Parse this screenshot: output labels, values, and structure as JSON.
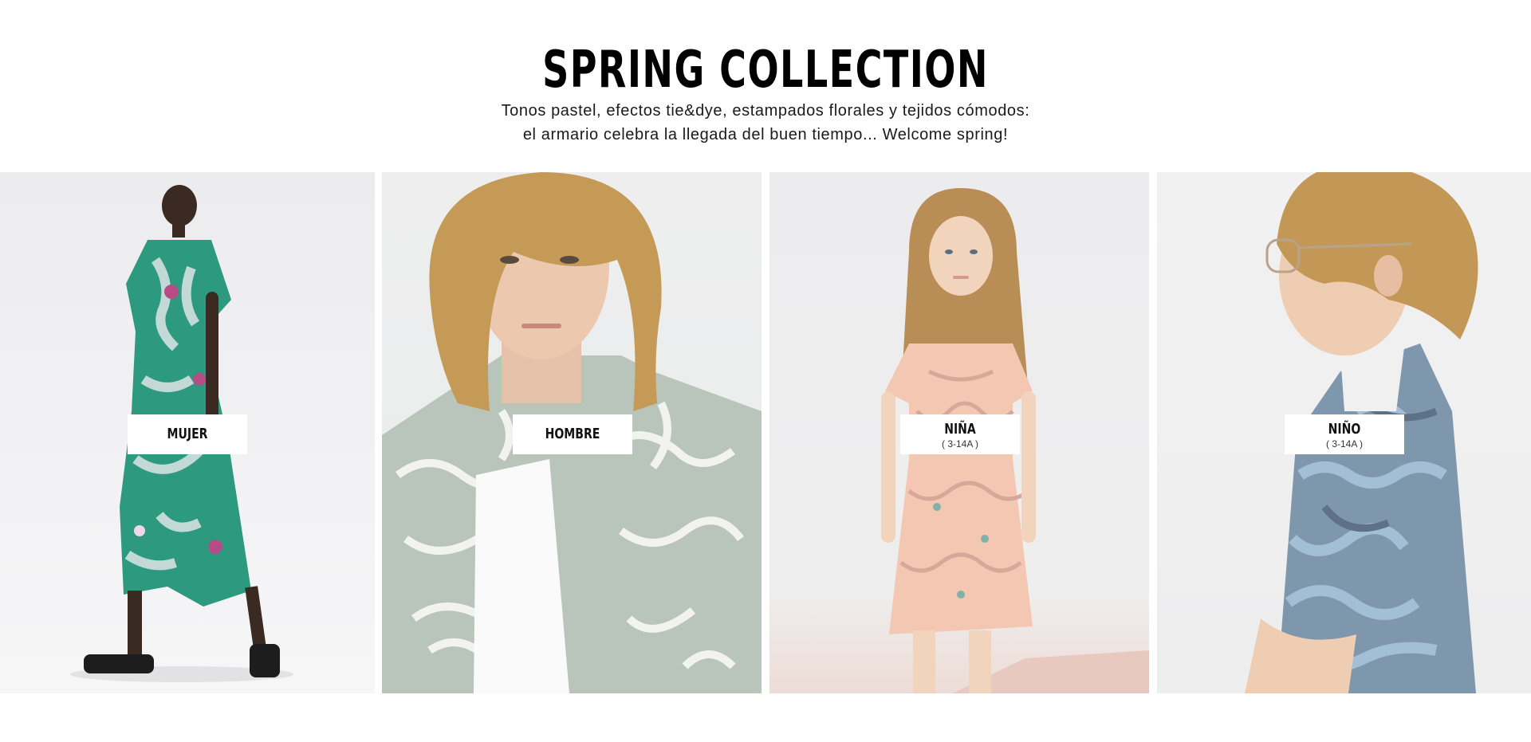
{
  "header": {
    "title": "SPRING COLLECTION",
    "subtitle_line1": "Tonos pastel, efectos tie&dye, estampados florales y tejidos cómodos:",
    "subtitle_line2": "el armario celebra la llegada del buen tiempo... Welcome spring!"
  },
  "categories": [
    {
      "name": "MUJER",
      "age": ""
    },
    {
      "name": "HOMBRE",
      "age": ""
    },
    {
      "name": "NIÑA",
      "age": "( 3-14A )"
    },
    {
      "name": "NIÑO",
      "age": "( 3-14A )"
    }
  ],
  "colors": {
    "background": "#ffffff",
    "title": "#000000",
    "label_background": "#ffffff"
  }
}
